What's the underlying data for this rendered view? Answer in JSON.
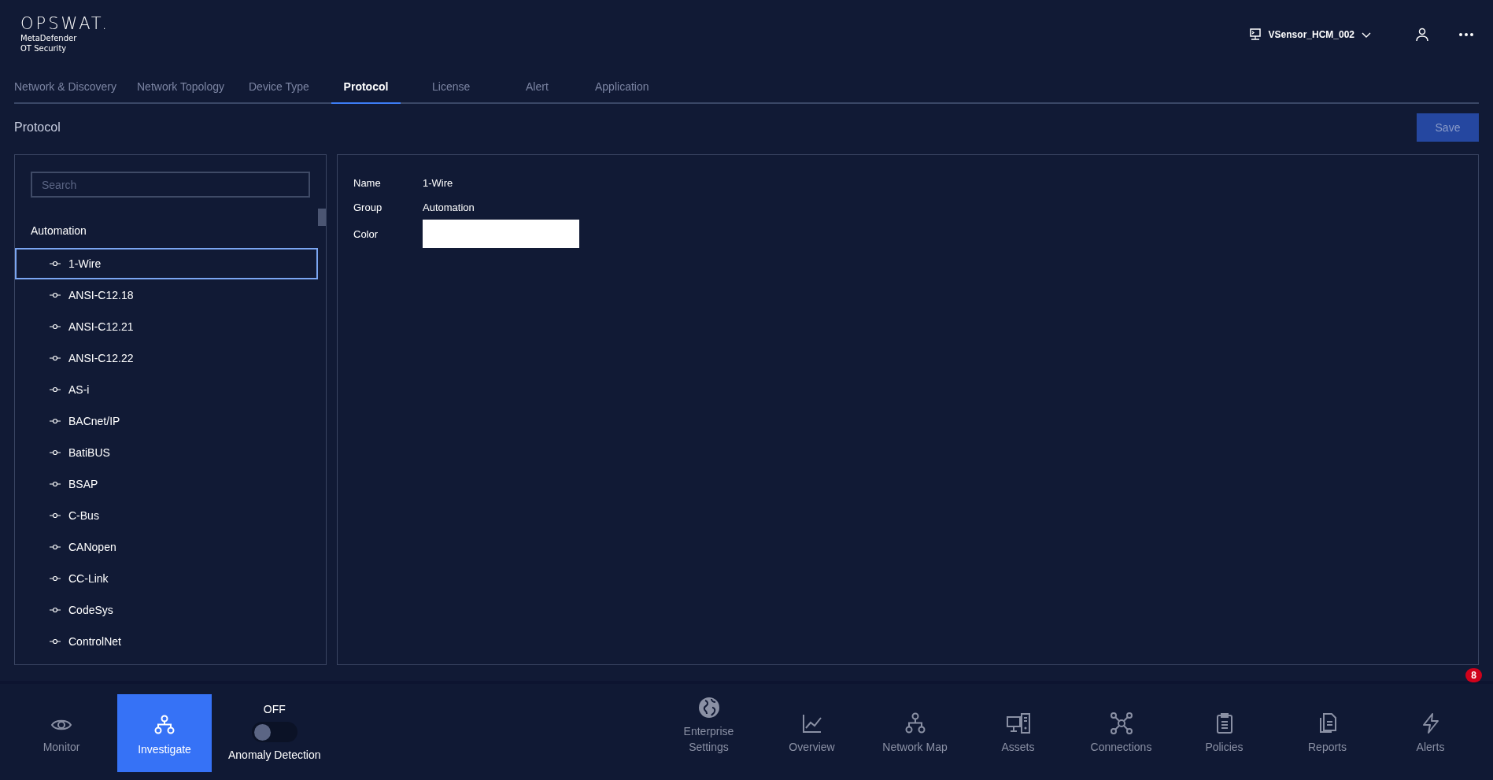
{
  "brand": {
    "logo": "OPSWAT.",
    "product": "MetaDefender",
    "subtitle": "OT Security"
  },
  "header": {
    "sensor": "VSensor_HCM_002"
  },
  "tabs": [
    {
      "label": "Network & Discovery",
      "selected": false
    },
    {
      "label": "Network Topology",
      "selected": false
    },
    {
      "label": "Device Type",
      "selected": false
    },
    {
      "label": "Protocol",
      "selected": true
    },
    {
      "label": "License",
      "selected": false
    },
    {
      "label": "Alert",
      "selected": false
    },
    {
      "label": "Application",
      "selected": false
    }
  ],
  "page_title": "Protocol",
  "save_button": "Save",
  "search": {
    "placeholder": "Search"
  },
  "protocol_tree": {
    "group": "Automation",
    "items": [
      {
        "label": "1-Wire",
        "selected": true
      },
      {
        "label": "ANSI-C12.18",
        "selected": false
      },
      {
        "label": "ANSI-C12.21",
        "selected": false
      },
      {
        "label": "ANSI-C12.22",
        "selected": false
      },
      {
        "label": "AS-i",
        "selected": false
      },
      {
        "label": "BACnet/IP",
        "selected": false
      },
      {
        "label": "BatiBUS",
        "selected": false
      },
      {
        "label": "BSAP",
        "selected": false
      },
      {
        "label": "C-Bus",
        "selected": false
      },
      {
        "label": "CANopen",
        "selected": false
      },
      {
        "label": "CC-Link",
        "selected": false
      },
      {
        "label": "CodeSys",
        "selected": false
      },
      {
        "label": "ControlNet",
        "selected": false
      }
    ]
  },
  "details": {
    "name_label": "Name",
    "name": "1-Wire",
    "group_label": "Group",
    "group": "Automation",
    "color_label": "Color",
    "color": "#ffffff"
  },
  "bottom_nav": {
    "modes": [
      {
        "label": "Monitor",
        "selected": false
      },
      {
        "label": "Investigate",
        "selected": true
      }
    ],
    "anomaly": {
      "state": "OFF",
      "on": false,
      "label": "Anomaly Detection"
    },
    "items": [
      {
        "label": "Enterprise Settings"
      },
      {
        "label": "Overview"
      },
      {
        "label": "Network Map"
      },
      {
        "label": "Assets"
      },
      {
        "label": "Connections"
      },
      {
        "label": "Policies"
      },
      {
        "label": "Reports"
      },
      {
        "label": "Alerts",
        "badge": "8"
      }
    ]
  }
}
